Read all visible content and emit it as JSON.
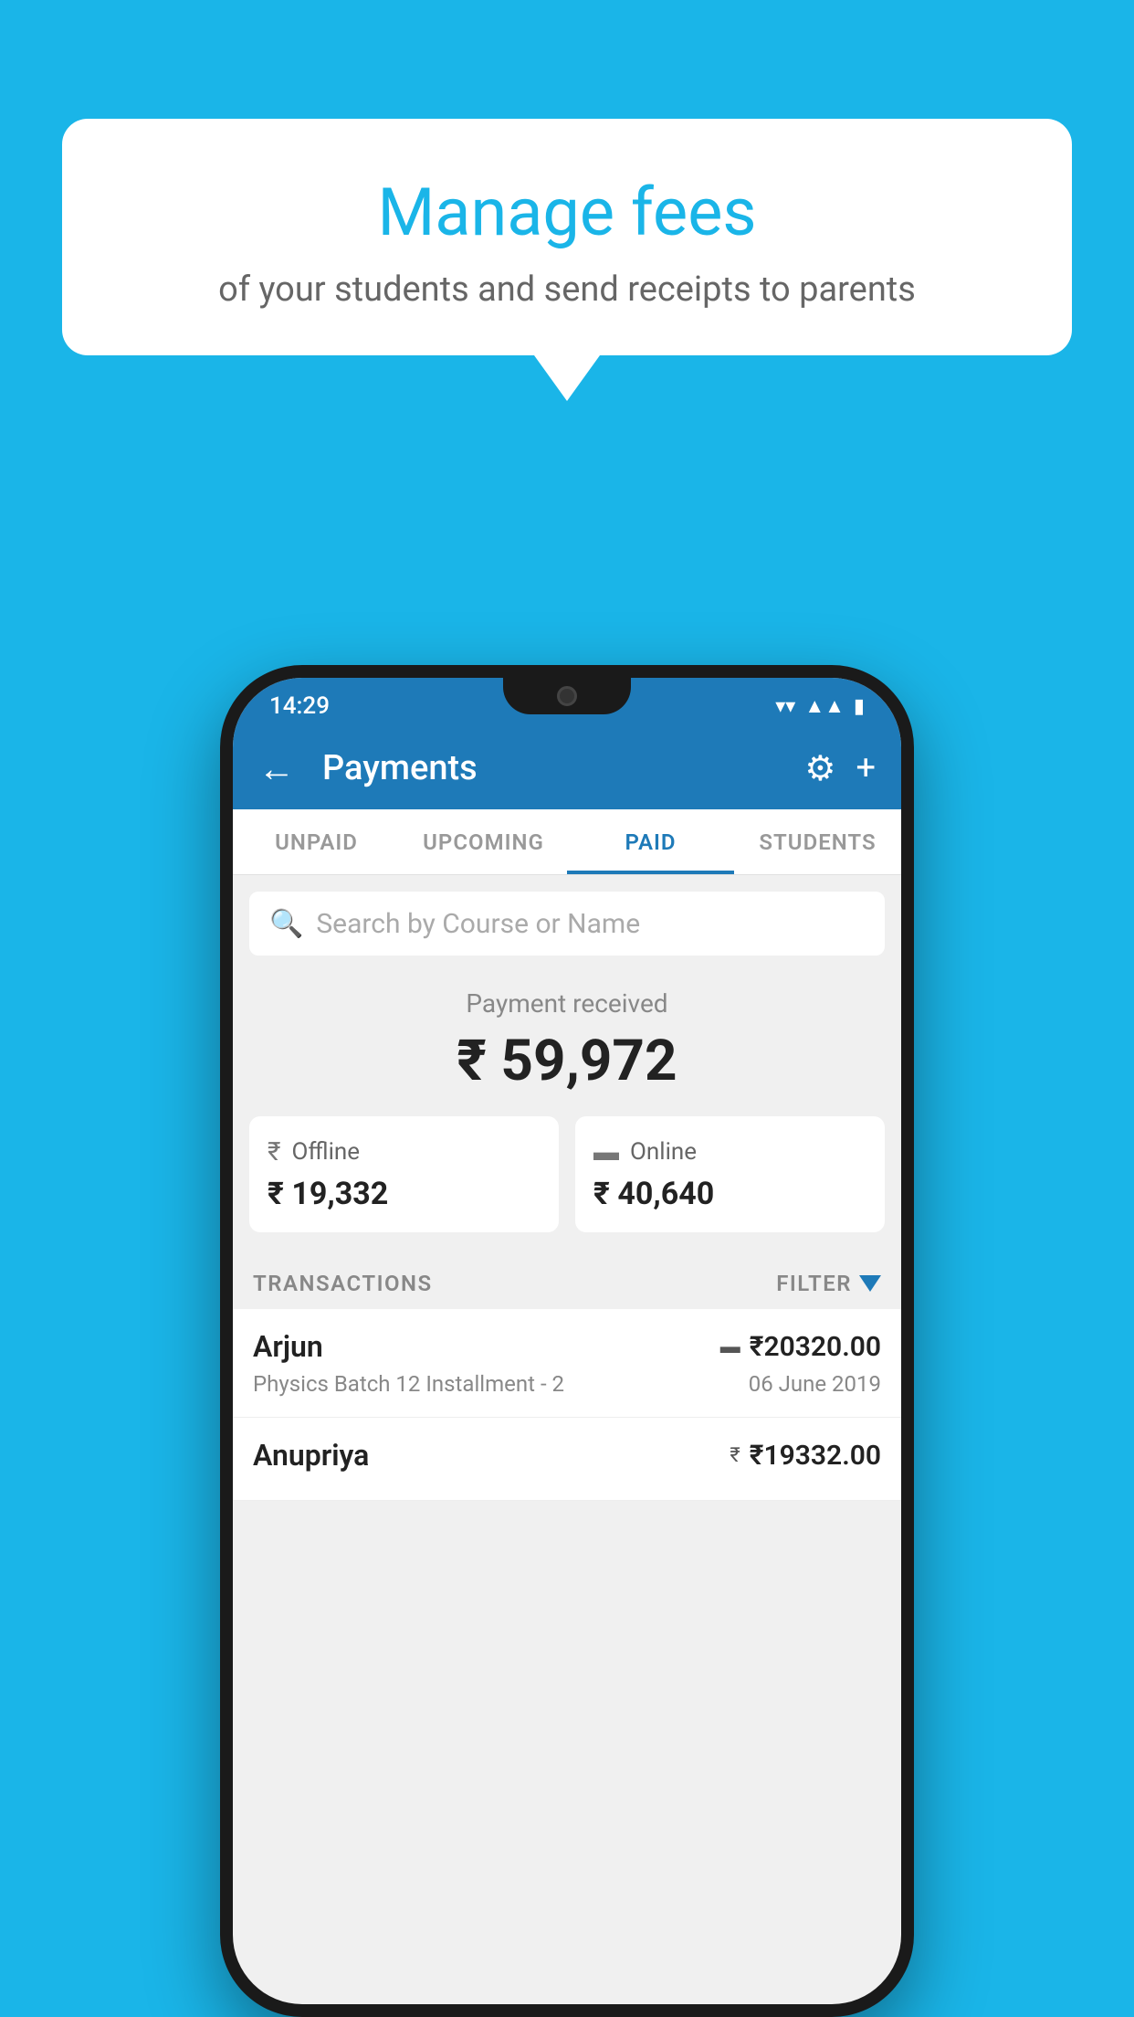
{
  "background_color": "#1ab5e8",
  "speech_bubble": {
    "title": "Manage fees",
    "subtitle": "of your students and send receipts to parents"
  },
  "status_bar": {
    "time": "14:29",
    "wifi_icon": "▾",
    "signal_icon": "▲",
    "battery_icon": "▮"
  },
  "app_bar": {
    "title": "Payments",
    "back_icon": "←",
    "gear_icon": "⚙",
    "plus_icon": "+"
  },
  "tabs": [
    {
      "label": "UNPAID",
      "active": false
    },
    {
      "label": "UPCOMING",
      "active": false
    },
    {
      "label": "PAID",
      "active": true
    },
    {
      "label": "STUDENTS",
      "active": false
    }
  ],
  "search": {
    "placeholder": "Search by Course or Name"
  },
  "payment_received": {
    "label": "Payment received",
    "amount": "₹ 59,972"
  },
  "payment_cards": [
    {
      "icon_label": "offline-icon",
      "icon": "₹",
      "label": "Offline",
      "amount": "₹ 19,332"
    },
    {
      "icon_label": "online-icon",
      "icon": "▬",
      "label": "Online",
      "amount": "₹ 40,640"
    }
  ],
  "transactions_section": {
    "label": "TRANSACTIONS",
    "filter_label": "FILTER"
  },
  "transactions": [
    {
      "name": "Arjun",
      "description": "Physics Batch 12 Installment - 2",
      "amount": "₹20320.00",
      "date": "06 June 2019",
      "payment_type": "online"
    },
    {
      "name": "Anupriya",
      "description": "",
      "amount": "₹19332.00",
      "date": "",
      "payment_type": "offline"
    }
  ]
}
